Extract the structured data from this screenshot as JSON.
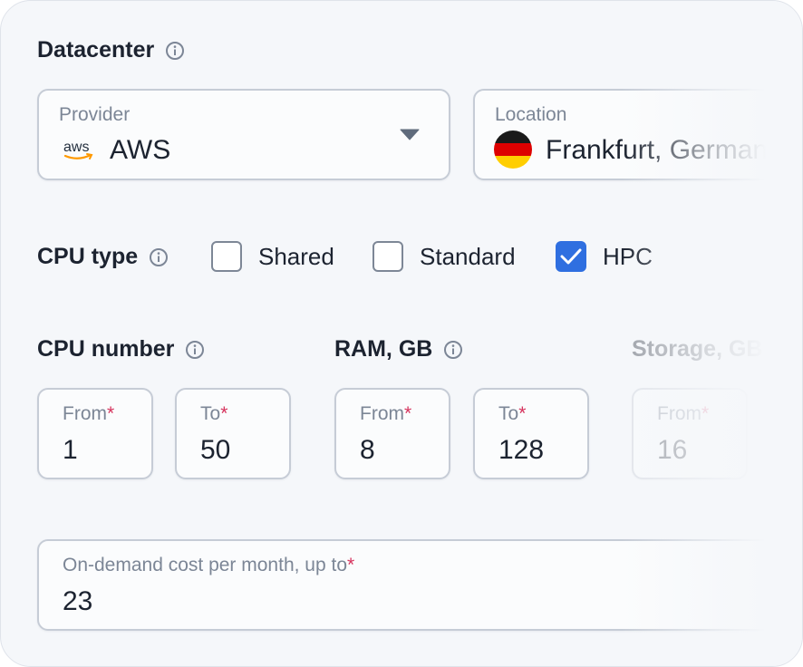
{
  "datacenter": {
    "title": "Datacenter",
    "provider": {
      "label": "Provider",
      "value": "AWS",
      "logo_text": "aws"
    },
    "location": {
      "label": "Location",
      "value": "Frankfurt, Germany"
    }
  },
  "cpu_type": {
    "title": "CPU type",
    "options": [
      {
        "label": "Shared",
        "checked": false
      },
      {
        "label": "Standard",
        "checked": false
      },
      {
        "label": "HPC",
        "checked": true
      }
    ]
  },
  "cpu_number": {
    "title": "CPU number",
    "from_label": "From",
    "from_value": "1",
    "to_label": "To",
    "to_value": "50"
  },
  "ram": {
    "title": "RAM, GB",
    "from_label": "From",
    "from_value": "8",
    "to_label": "To",
    "to_value": "128"
  },
  "storage": {
    "title": "Storage, GB",
    "from_label": "From",
    "from_value": "16"
  },
  "cost": {
    "label": "On-demand cost per month, up to",
    "value": "23"
  },
  "colors": {
    "accent": "#2f6fe0",
    "required": "#d6335d",
    "border": "#c6ccd6"
  }
}
